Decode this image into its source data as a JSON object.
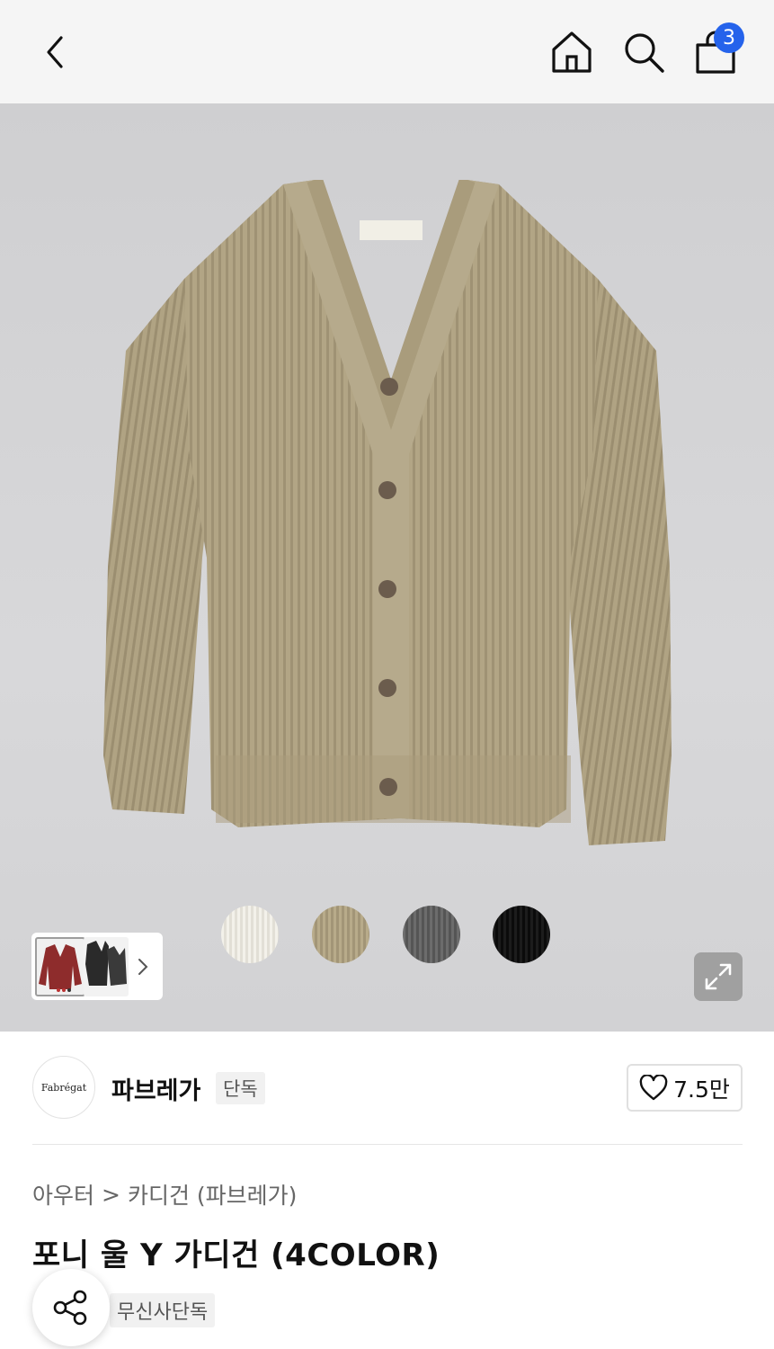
{
  "header": {
    "back_icon": "chevron-left-icon",
    "home_icon": "home-icon",
    "search_icon": "search-icon",
    "cart_icon": "shopping-bag-icon",
    "cart_count": "3",
    "badge_color": "#2563eb"
  },
  "gallery": {
    "color_swatches": [
      "ivory",
      "beige",
      "gray",
      "black"
    ],
    "expand_icon": "expand-icon",
    "more_icon": "chevron-right-icon"
  },
  "brand": {
    "logo_text": "Fabrégat",
    "name": "파브레가",
    "tag": "단독",
    "like_icon": "heart-icon",
    "like_count": "7.5만"
  },
  "breadcrumb": {
    "items": [
      "아우터",
      "카디건 (파브레가)"
    ],
    "separator": ">"
  },
  "product": {
    "title": "포니 울 Y 가디건 (4COLOR)",
    "exclusive_tag": "무신사단독"
  },
  "share": {
    "icon": "share-icon"
  }
}
